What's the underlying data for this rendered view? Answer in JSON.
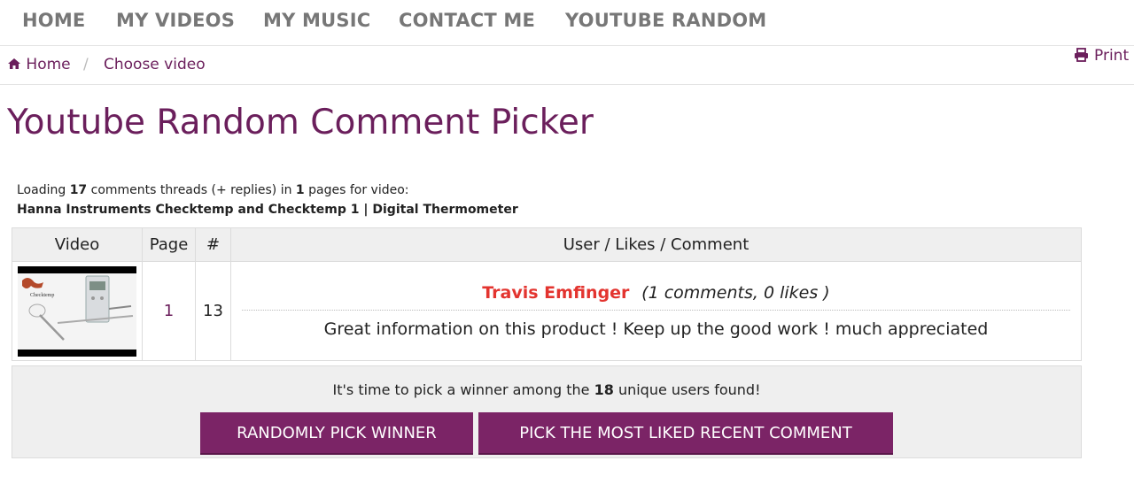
{
  "nav": {
    "items": [
      "HOME",
      "MY VIDEOS",
      "MY MUSIC",
      "CONTACT ME",
      "YOUTUBE RANDOM"
    ]
  },
  "breadcrumb": {
    "home": "Home",
    "current": "Choose video",
    "separator": "/"
  },
  "print_label": "Print",
  "page_title": "Youtube Random Comment Picker",
  "loading": {
    "prefix": "Loading",
    "comment_threads": "17",
    "middle": "comments threads (+ replies) in",
    "pages": "1",
    "suffix": "pages for video:",
    "video_title": "Hanna Instruments Checktemp and Checktemp 1 | Digital Thermometer"
  },
  "table": {
    "headers": [
      "Video",
      "Page",
      "#",
      "User / Likes / Comment"
    ],
    "rows": [
      {
        "page": "1",
        "number": "13",
        "user": "Travis Emfinger",
        "meta": "(1 comments, 0 likes )",
        "comment": "Great information on this product ! Keep up the good work ! much appreciated"
      }
    ]
  },
  "pick": {
    "text_before": "It's time to pick a winner among the",
    "unique_users": "18",
    "text_after": "unique users found!",
    "random_button": "RANDOMLY PICK WINNER",
    "liked_button": "PICK THE MOST LIKED RECENT COMMENT"
  },
  "colors": {
    "brand": "#6b1f5c",
    "button": "#7b2466",
    "username": "#e3342f",
    "nav_text": "#777777"
  }
}
